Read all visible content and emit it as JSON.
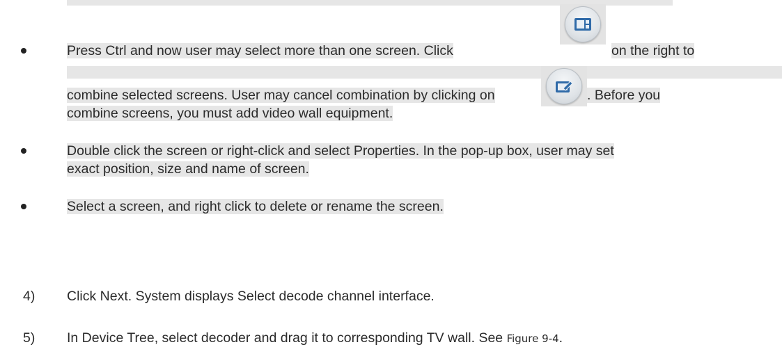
{
  "bullets": [
    {
      "line1_before": "Press Ctrl and now user may select more than one screen. Click ",
      "line1_after": " on the right to",
      "line2_before": "combine selected screens. User may cancel combination by clicking on ",
      "line2_after": ". Before you",
      "line3": "combine screens, you must add video wall equipment. ",
      "combine_icon": "combine-screens-icon",
      "cancel_icon": "cancel-combination-icon"
    },
    {
      "line1": "Double click the screen or right-click and select Properties. In the pop-up box, user may set",
      "line2": "exact position, size and name of screen. "
    },
    {
      "line1": "Select a screen, and right click to delete or rename the screen. "
    }
  ],
  "steps": [
    {
      "number": "4)",
      "text": "Click Next. System displays Select decode channel interface."
    },
    {
      "number": "5)",
      "text_before": "In Device Tree, select decoder and drag it to corresponding TV wall. See ",
      "figure_ref": "Figure 9-4",
      "text_after": "."
    }
  ],
  "colors": {
    "highlight": "#e6e6e6",
    "text": "#2b2b2b",
    "icon_blue": "#2f6aa8"
  }
}
